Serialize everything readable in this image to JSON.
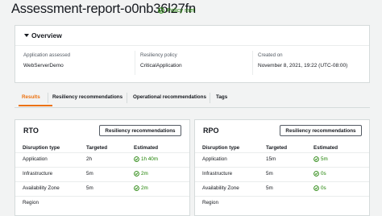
{
  "page": {
    "title": "Assessment-report-o0nb36l27fn",
    "policy_status": "Policy met"
  },
  "overview": {
    "title": "Overview",
    "fields": [
      {
        "label": "Application assessed",
        "value": "WebServerDemo"
      },
      {
        "label": "Resiliency policy",
        "value": "CriticalApplication"
      },
      {
        "label": "Created on",
        "value": "November 8, 2021, 19:22 (UTC-08:00)"
      }
    ]
  },
  "tabs": [
    {
      "label": "Results",
      "active": true
    },
    {
      "label": "Resiliency recommendations",
      "active": false
    },
    {
      "label": "Operational recommendations",
      "active": false
    },
    {
      "label": "Tags",
      "active": false
    }
  ],
  "cards": [
    {
      "title": "RTO",
      "button_label": "Resiliency recommendations",
      "columns": [
        "Disruption type",
        "Targeted",
        "Estimated"
      ],
      "rows": [
        {
          "type": "Application",
          "targeted": "2h",
          "estimated": "1h 40m"
        },
        {
          "type": "Infrastructure",
          "targeted": "5m",
          "estimated": "2m"
        },
        {
          "type": "Availability Zone",
          "targeted": "5m",
          "estimated": "2m"
        },
        {
          "type": "Region",
          "targeted": "",
          "estimated": ""
        }
      ]
    },
    {
      "title": "RPO",
      "button_label": "Resiliency recommendations",
      "columns": [
        "Disruption type",
        "Targeted",
        "Estimated"
      ],
      "rows": [
        {
          "type": "Application",
          "targeted": "15m",
          "estimated": "5m"
        },
        {
          "type": "Infrastructure",
          "targeted": "5m",
          "estimated": "0s"
        },
        {
          "type": "Availability Zone",
          "targeted": "5m",
          "estimated": "0s"
        },
        {
          "type": "Region",
          "targeted": "",
          "estimated": ""
        }
      ]
    }
  ],
  "colors": {
    "accent": "#ec7211",
    "success": "#1d8102",
    "text": "#16191f",
    "background": "#f2f3f3"
  }
}
